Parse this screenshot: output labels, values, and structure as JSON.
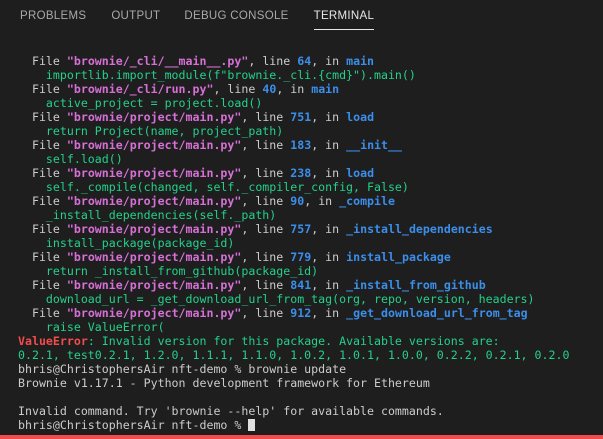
{
  "tabs": [
    {
      "label": "PROBLEMS",
      "active": false
    },
    {
      "label": "OUTPUT",
      "active": false
    },
    {
      "label": "DEBUG CONSOLE",
      "active": false
    },
    {
      "label": "TERMINAL",
      "active": true
    }
  ],
  "colors": {
    "background": "#1e1e1e",
    "path": "#d670d6",
    "number": "#3b8eea",
    "code": "#23d18b",
    "error": "#f14c4c",
    "text": "#cccccc"
  },
  "terminal": {
    "lines": [
      [
        {
          "t": "  File ",
          "c": ""
        },
        {
          "t": "\"brownie/_cli/__main__.py\"",
          "c": "path"
        },
        {
          "t": ", line ",
          "c": ""
        },
        {
          "t": "64",
          "c": "num"
        },
        {
          "t": ", in ",
          "c": ""
        },
        {
          "t": "main",
          "c": "func"
        }
      ],
      [
        {
          "t": "    importlib.import_module(f\"brownie._cli.{cmd}\").main()",
          "c": "code"
        }
      ],
      [
        {
          "t": "  File ",
          "c": ""
        },
        {
          "t": "\"brownie/_cli/run.py\"",
          "c": "path"
        },
        {
          "t": ", line ",
          "c": ""
        },
        {
          "t": "40",
          "c": "num"
        },
        {
          "t": ", in ",
          "c": ""
        },
        {
          "t": "main",
          "c": "func"
        }
      ],
      [
        {
          "t": "    active_project = project.load()",
          "c": "code"
        }
      ],
      [
        {
          "t": "  File ",
          "c": ""
        },
        {
          "t": "\"brownie/project/main.py\"",
          "c": "path"
        },
        {
          "t": ", line ",
          "c": ""
        },
        {
          "t": "751",
          "c": "num"
        },
        {
          "t": ", in ",
          "c": ""
        },
        {
          "t": "load",
          "c": "func"
        }
      ],
      [
        {
          "t": "    return Project(name, project_path)",
          "c": "code"
        }
      ],
      [
        {
          "t": "  File ",
          "c": ""
        },
        {
          "t": "\"brownie/project/main.py\"",
          "c": "path"
        },
        {
          "t": ", line ",
          "c": ""
        },
        {
          "t": "183",
          "c": "num"
        },
        {
          "t": ", in ",
          "c": ""
        },
        {
          "t": "__init__",
          "c": "func"
        }
      ],
      [
        {
          "t": "    self.load()",
          "c": "code"
        }
      ],
      [
        {
          "t": "  File ",
          "c": ""
        },
        {
          "t": "\"brownie/project/main.py\"",
          "c": "path"
        },
        {
          "t": ", line ",
          "c": ""
        },
        {
          "t": "238",
          "c": "num"
        },
        {
          "t": ", in ",
          "c": ""
        },
        {
          "t": "load",
          "c": "func"
        }
      ],
      [
        {
          "t": "    self._compile(changed, self._compiler_config, False)",
          "c": "code"
        }
      ],
      [
        {
          "t": "  File ",
          "c": ""
        },
        {
          "t": "\"brownie/project/main.py\"",
          "c": "path"
        },
        {
          "t": ", line ",
          "c": ""
        },
        {
          "t": "90",
          "c": "num"
        },
        {
          "t": ", in ",
          "c": ""
        },
        {
          "t": "_compile",
          "c": "func"
        }
      ],
      [
        {
          "t": "    _install_dependencies(self._path)",
          "c": "code"
        }
      ],
      [
        {
          "t": "  File ",
          "c": ""
        },
        {
          "t": "\"brownie/project/main.py\"",
          "c": "path"
        },
        {
          "t": ", line ",
          "c": ""
        },
        {
          "t": "757",
          "c": "num"
        },
        {
          "t": ", in ",
          "c": ""
        },
        {
          "t": "_install_dependencies",
          "c": "func"
        }
      ],
      [
        {
          "t": "    install_package(package_id)",
          "c": "code"
        }
      ],
      [
        {
          "t": "  File ",
          "c": ""
        },
        {
          "t": "\"brownie/project/main.py\"",
          "c": "path"
        },
        {
          "t": ", line ",
          "c": ""
        },
        {
          "t": "779",
          "c": "num"
        },
        {
          "t": ", in ",
          "c": ""
        },
        {
          "t": "install_package",
          "c": "func"
        }
      ],
      [
        {
          "t": "    return _install_from_github(package_id)",
          "c": "code"
        }
      ],
      [
        {
          "t": "  File ",
          "c": ""
        },
        {
          "t": "\"brownie/project/main.py\"",
          "c": "path"
        },
        {
          "t": ", line ",
          "c": ""
        },
        {
          "t": "841",
          "c": "num"
        },
        {
          "t": ", in ",
          "c": ""
        },
        {
          "t": "_install_from_github",
          "c": "func"
        }
      ],
      [
        {
          "t": "    download_url = _get_download_url_from_tag(org, repo, version, headers)",
          "c": "code"
        }
      ],
      [
        {
          "t": "  File ",
          "c": ""
        },
        {
          "t": "\"brownie/project/main.py\"",
          "c": "path"
        },
        {
          "t": ", line ",
          "c": ""
        },
        {
          "t": "912",
          "c": "num"
        },
        {
          "t": ", in ",
          "c": ""
        },
        {
          "t": "_get_download_url_from_tag",
          "c": "func"
        }
      ],
      [
        {
          "t": "    raise ValueError(",
          "c": "code"
        }
      ],
      [
        {
          "t": "ValueError",
          "c": "err"
        },
        {
          "t": ": Invalid version for this package. Available versions are:",
          "c": "errmsg"
        }
      ],
      [
        {
          "t": "0.2.1, test0.2.1, 1.2.0, 1.1.1, 1.1.0, 1.0.2, 1.0.1, 1.0.0, 0.2.2, 0.2.1, 0.2.0",
          "c": "errmsg"
        }
      ],
      [
        {
          "t": "bhris@ChristophersAir nft-demo % brownie update",
          "c": ""
        }
      ],
      [
        {
          "t": "Brownie v1.17.1 - Python development framework for Ethereum",
          "c": ""
        }
      ],
      [
        {
          "t": "",
          "c": ""
        }
      ],
      [
        {
          "t": "Invalid command. Try 'brownie --help' for available commands.",
          "c": ""
        }
      ],
      [
        {
          "t": "bhris@ChristophersAir nft-demo % ",
          "c": ""
        },
        {
          "t": "",
          "c": "cursor"
        }
      ]
    ]
  }
}
